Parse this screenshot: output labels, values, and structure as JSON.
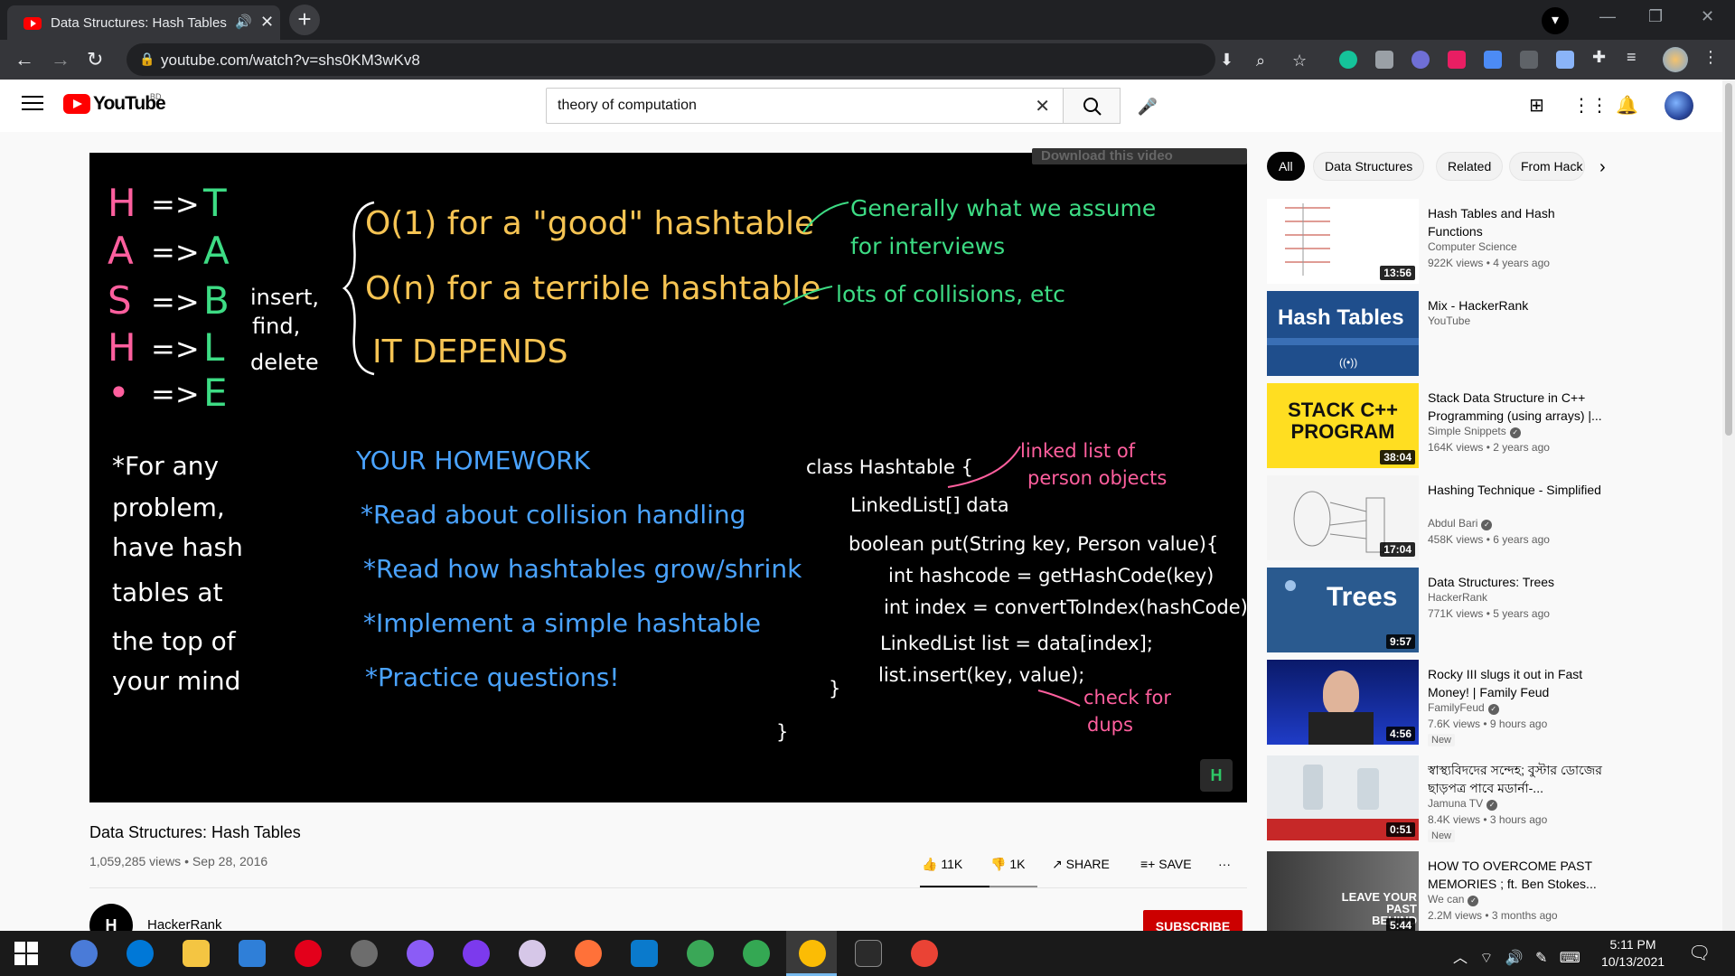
{
  "browser": {
    "tab_title": "Data Structures: Hash Tables",
    "url": "youtube.com/watch?v=shs0KM3wKv8"
  },
  "youtube": {
    "logo_text": "YouTube",
    "country_code": "BD",
    "search_query": "theory of computation"
  },
  "video": {
    "download_overlay": "Download this video",
    "title": "Data Structures: Hash Tables",
    "meta": "1,059,285 views • Sep 28, 2016",
    "likes": "11K",
    "dislikes": "1K",
    "share_label": "SHARE",
    "save_label": "SAVE",
    "more_label": "···",
    "channel_name": "HackerRank",
    "channel_avatar_text": "H",
    "subscribe_label": "SUBSCRIBE",
    "board": {
      "acrostic": [
        {
          "left": "H",
          "right": "T",
          "color": "#ff5f9e"
        },
        {
          "left": "A",
          "right": "A",
          "color": "#ff5f9e"
        },
        {
          "left": "S",
          "right": "B",
          "color": "#ff5f9e"
        },
        {
          "left": "H",
          "right": "L",
          "color": "#ff5f9e"
        },
        {
          "left": "•",
          "right": "E",
          "color": "#ff5f9e"
        }
      ],
      "arrow": "=>",
      "ops": [
        "insert,",
        "find,",
        "delete"
      ],
      "complexity": [
        "O(1) for a \"good\" hashtable",
        "O(n) for a terrible hashtable",
        "IT DEPENDS"
      ],
      "notes_green": [
        "Generally what we assume",
        "for interviews",
        "lots of collisions, etc"
      ],
      "left_note": [
        "*For any",
        "problem,",
        "have hash",
        "tables at",
        "the top of",
        "your mind"
      ],
      "homework_title": "YOUR HOMEWORK",
      "homework": [
        "*Read about collision handling",
        "*Read how hashtables grow/shrink",
        "*Implement a simple hashtable",
        "*Practice questions!"
      ],
      "code": [
        "class Hashtable {",
        "LinkedList[] data",
        "boolean put(String key, Person value){",
        "int hashcode = getHashCode(key)",
        "int index = convertToIndex(hashCode)",
        "LinkedList list = data[index];",
        "list.insert(key, value);",
        "}",
        "}"
      ],
      "pink_notes": [
        "linked list of",
        "person objects",
        "check for",
        "dups"
      ],
      "watermark": "H"
    }
  },
  "chips": [
    "All",
    "Data Structures",
    "Related",
    "From Hack"
  ],
  "recommendations": [
    {
      "title": "Hash Tables and Hash Functions",
      "channel": "Computer Science",
      "views": "922K views • 4 years ago",
      "duration": "13:56",
      "verified": false,
      "new": false,
      "thumb_label": ""
    },
    {
      "title": "Mix - HackerRank",
      "channel": "YouTube",
      "views": "",
      "duration": "",
      "verified": false,
      "new": false,
      "thumb_label": "Hash Tables"
    },
    {
      "title": "Stack Data Structure in C++ Programming (using arrays) |...",
      "channel": "Simple Snippets",
      "views": "164K views • 2 years ago",
      "duration": "38:04",
      "verified": true,
      "new": false,
      "thumb_label": "STACK C++ PROGRAM"
    },
    {
      "title": "Hashing Technique - Simplified",
      "channel": "Abdul Bari",
      "views": "458K views • 6 years ago",
      "duration": "17:04",
      "verified": true,
      "new": false,
      "thumb_label": ""
    },
    {
      "title": "Data Structures: Trees",
      "channel": "HackerRank",
      "views": "771K views • 5 years ago",
      "duration": "9:57",
      "verified": false,
      "new": false,
      "thumb_label": "Trees"
    },
    {
      "title": "Rocky III slugs it out in Fast Money! | Family Feud",
      "channel": "FamilyFeud",
      "views": "7.6K views • 9 hours ago",
      "duration": "4:56",
      "verified": true,
      "new": true,
      "thumb_label": ""
    },
    {
      "title": "স্বাস্থ্যবিদদের সন্দেহ; বুস্টার ডোজের ছাড়পত্র পাবে মডার্না-...",
      "channel": "Jamuna TV",
      "views": "8.4K views • 3 hours ago",
      "duration": "0:51",
      "verified": true,
      "new": true,
      "thumb_label": ""
    },
    {
      "title": "HOW TO OVERCOME PAST MEMORIES ; ft. Ben Stokes...",
      "channel": "We can",
      "views": "2.2M views • 3 months ago",
      "duration": "5:44",
      "verified": true,
      "new": false,
      "thumb_label": "LEAVE YOUR PAST BEHIND"
    }
  ],
  "new_badge": "New",
  "taskbar": {
    "time": "5:11 PM",
    "date": "10/13/2021"
  },
  "colors": {
    "yt_red": "#ff0000",
    "board_pink": "#ff5f9e",
    "board_green": "#3ddc84",
    "board_yellow": "#f6c453",
    "board_blue": "#4aa3ff",
    "board_white": "#ffffff"
  }
}
